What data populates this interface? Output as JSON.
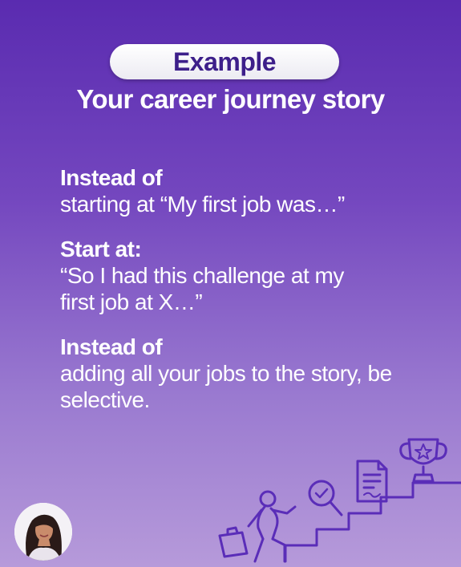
{
  "header": {
    "badge_label": "Example",
    "title": "Your career journey story"
  },
  "tips": [
    {
      "heading": "Instead of",
      "text": "starting at “My first job was…”"
    },
    {
      "heading": "Start at:",
      "text": "“So I had this challenge at my first job at X…”"
    },
    {
      "heading": "Instead of",
      "text": "adding all your jobs to the story, be selective."
    }
  ],
  "illustration": {
    "icons": [
      "person-climbing-icon",
      "briefcase-icon",
      "magnifier-check-icon",
      "document-icon",
      "trophy-star-icon",
      "stairs-icon"
    ],
    "line_color": "#5a2db8"
  },
  "colors": {
    "background_top": "#5a2bb0",
    "background_bottom": "#b69ada",
    "badge_text": "#3d1f8a",
    "text": "#ffffff"
  }
}
